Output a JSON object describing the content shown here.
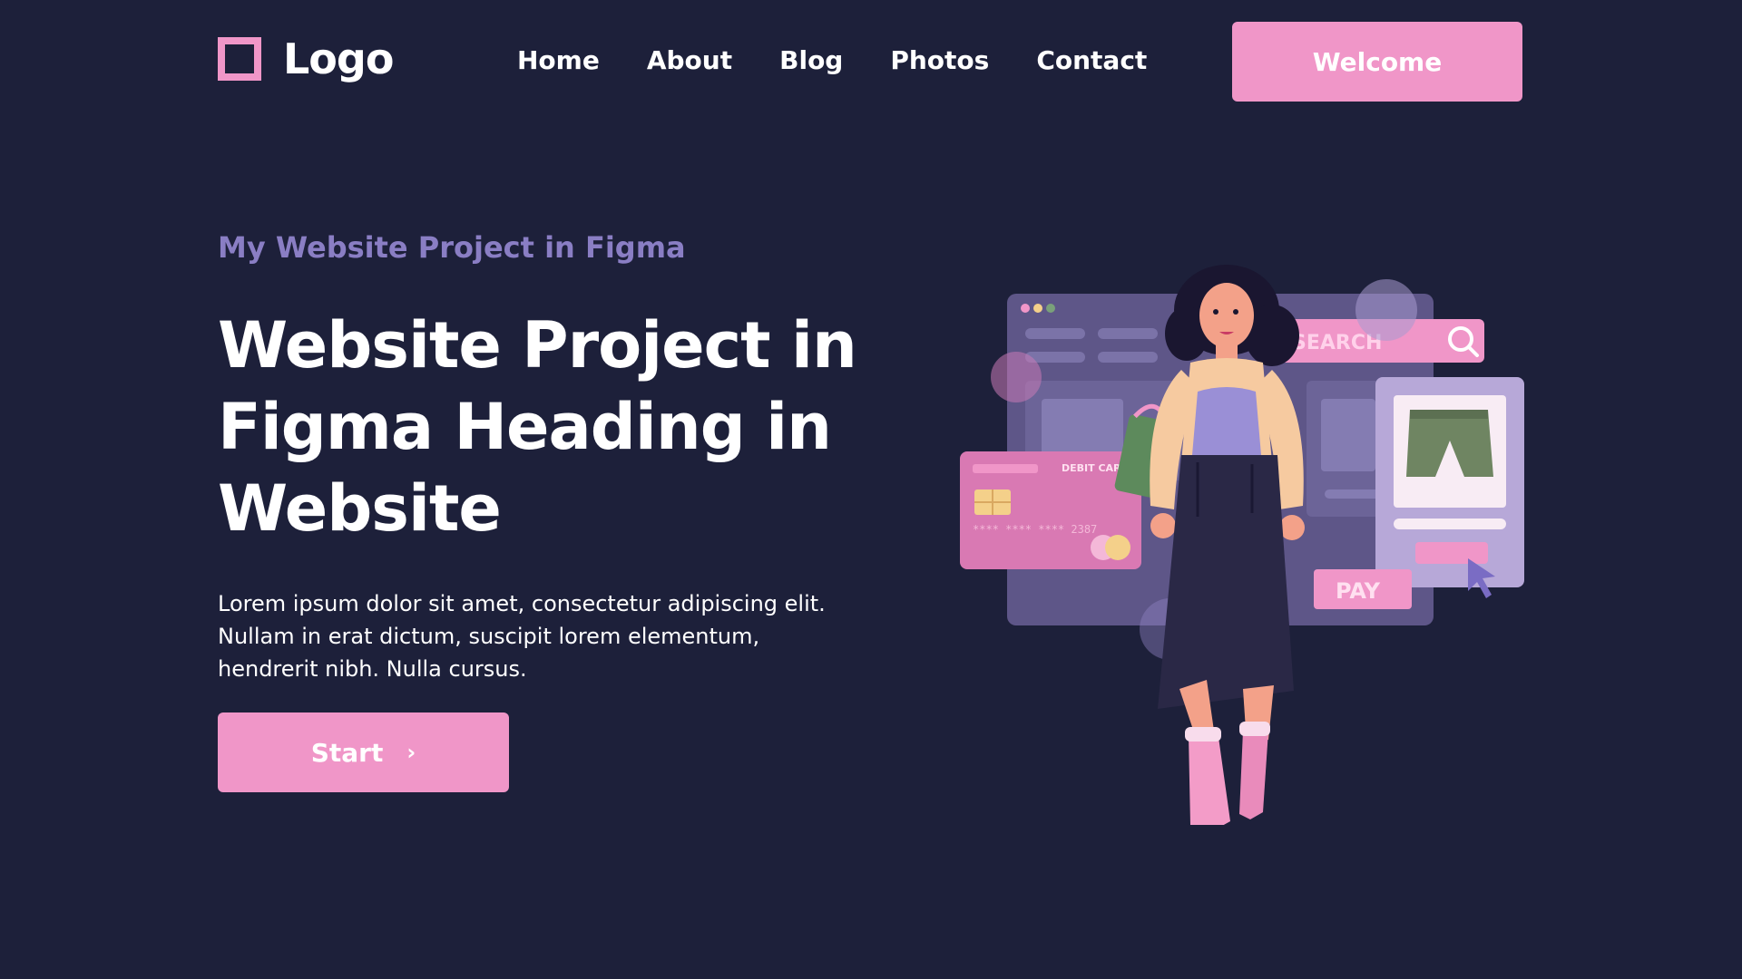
{
  "header": {
    "logo_text": "Logo",
    "nav": [
      "Home",
      "About",
      "Blog",
      "Photos",
      "Contact"
    ],
    "cta_label": "Welcome"
  },
  "hero": {
    "eyebrow": "My Website Project in Figma",
    "title": "Website Project in Figma Heading in Website",
    "body": "Lorem ipsum dolor sit amet, consectetur adipiscing elit. Nullam in erat dictum, suscipit lorem elementum, hendrerit nibh. Nulla cursus.",
    "start_label": "Start",
    "start_icon": "chevron-right-icon"
  },
  "illustration": {
    "search_label": "SEARCH",
    "card_label": "DEBIT CARD",
    "card_number": "**** **** **** 2387",
    "pay_label": "PAY"
  },
  "colors": {
    "background": "#1d203a",
    "accent": "#f096c8",
    "eyebrow": "#8a7ec4"
  }
}
